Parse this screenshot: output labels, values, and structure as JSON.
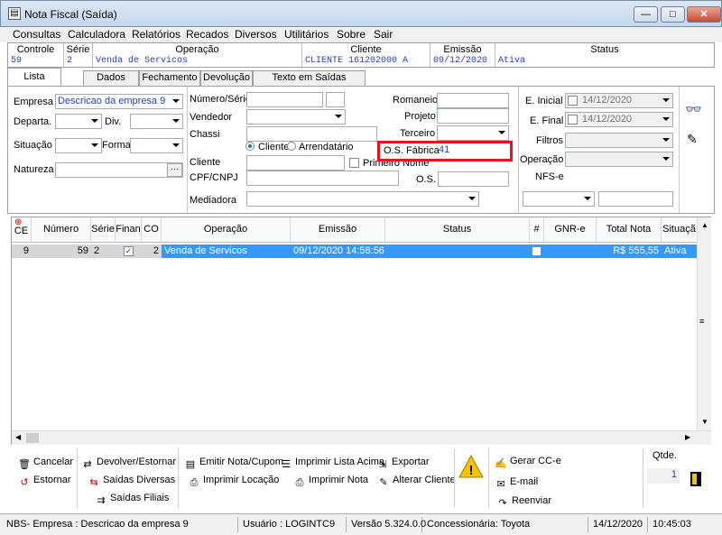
{
  "window": {
    "title": "Nota Fiscal (Saída)",
    "minimize": "—",
    "maximize": "□",
    "close": "✕"
  },
  "menu": [
    "Consultas",
    "Calculadora",
    "Relatórios",
    "Recados",
    "Diversos",
    "Utilitários",
    "Sobre",
    "Sair"
  ],
  "header": {
    "controle_label": "Controle",
    "controle": "59",
    "serie_label": "Série",
    "serie": "2",
    "operacao_label": "Operação",
    "operacao": "Venda de Servicos",
    "cliente_label": "Cliente",
    "cliente": "CLIENTE 161202000 A",
    "emissao_label": "Emissão",
    "emissao": "09/12/2020",
    "status_label": "Status",
    "status": "Ativa"
  },
  "tabs": [
    "Lista",
    "Dados",
    "Fechamento",
    "Devolução",
    "Texto em Saídas Diversas"
  ],
  "filters": {
    "empresa_label": "Empresa",
    "empresa": "Descricao da empresa 9",
    "departa_label": "Departa.",
    "div_label": "Div.",
    "situacao_label": "Situação",
    "forma_label": "Forma",
    "natureza_label": "Natureza",
    "natureza_btn": "···",
    "numero_serie_label": "Número/Série",
    "vendedor_label": "Vendedor",
    "chassi_label": "Chassi",
    "radio_cliente": "Cliente",
    "radio_arrendatario": "Arrendatário",
    "cliente_label": "Cliente",
    "cpf_label": "CPF/CNPJ",
    "mediadora_label": "Mediadora",
    "romaneio_label": "Romaneio",
    "projeto_label": "Projeto",
    "terceiro_label": "Terceiro",
    "os_fabrica_label": "O.S. Fábrica",
    "os_fabrica": "41",
    "primeiro_nome_label": "Primeiro Nome",
    "os_label": "O.S.",
    "e_inicial_label": "E. Inicial",
    "e_inicial": "14/12/2020",
    "e_final_label": "E. Final",
    "e_final": "14/12/2020",
    "filtros_label": "Filtros",
    "operacao_label": "Operação",
    "nfse_label": "NFS-e"
  },
  "grid": {
    "columns": [
      "CE",
      "Número",
      "Série",
      "Finan",
      "CO",
      "Operação",
      "Emissão",
      "Status",
      "#",
      "GNR-e",
      "Total Nota",
      "Situaçã"
    ],
    "rows": [
      {
        "ce": "9",
        "numero": "59",
        "serie": "2",
        "finan": "✓",
        "co": "2",
        "operacao": "Venda de Servicos",
        "emissao": "09/12/2020 14:58:56",
        "status": "",
        "hash": "",
        "gnre": "",
        "total": "R$ 555,55",
        "situacao": "Ativa"
      }
    ]
  },
  "toolbar": {
    "cancelar": "Cancelar",
    "estornar": "Estornar",
    "devolver": "Devolver/Estornar",
    "saidas_diversas": "Saídas Diversas",
    "saidas_filiais": "Saídas Filiais",
    "emitir": "Emitir Nota/Cupom",
    "imprimir_locacao": "Imprimir Locação",
    "imprimir_lista": "Imprimir Lista Acima",
    "imprimir_nota": "Imprimir Nota",
    "exportar": "Exportar",
    "alterar_cliente": "Alterar Cliente",
    "gerar_cce": "Gerar CC-e",
    "email": "E-mail",
    "reenviar": "Reenviar",
    "qtde_label": "Qtde.",
    "qtde": "1"
  },
  "statusbar": {
    "empresa": "NBS- Empresa : Descricao da empresa 9",
    "usuario": "Usuário : LOGINTC9",
    "versao": "Versão 5.324.0.0",
    "concessionaria": "Concessionária: Toyota",
    "data": "14/12/2020",
    "hora": "10:45:03"
  }
}
